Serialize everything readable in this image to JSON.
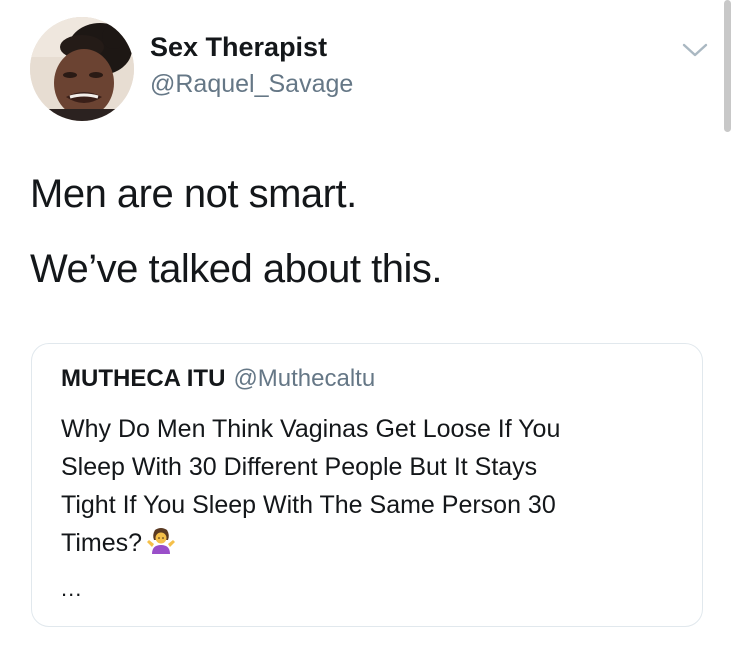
{
  "author": {
    "display_name": "Sex Therapist",
    "handle": "@Raquel_Savage"
  },
  "icons": {
    "avatar": "profile-photo-avatar",
    "menu": "chevron-down-icon",
    "emoji": "person-shrugging-emoji"
  },
  "tweet": {
    "lines": [
      "Men are not smart.",
      "We’ve talked about this."
    ]
  },
  "quoted_tweet": {
    "display_name": "MUTHECA ITU",
    "handle": "@Muthecaltu",
    "lines": [
      "Why Do Men Think Vaginas Get Loose If You",
      "Sleep With 30 Different People But It Stays",
      "Tight If You Sleep With The Same Person 30",
      "Times?"
    ],
    "truncation": "..."
  },
  "colors": {
    "text": "#14171a",
    "secondary_text": "#657786",
    "border": "#e1e8ed",
    "scrollbar": "#c8c8c8"
  }
}
